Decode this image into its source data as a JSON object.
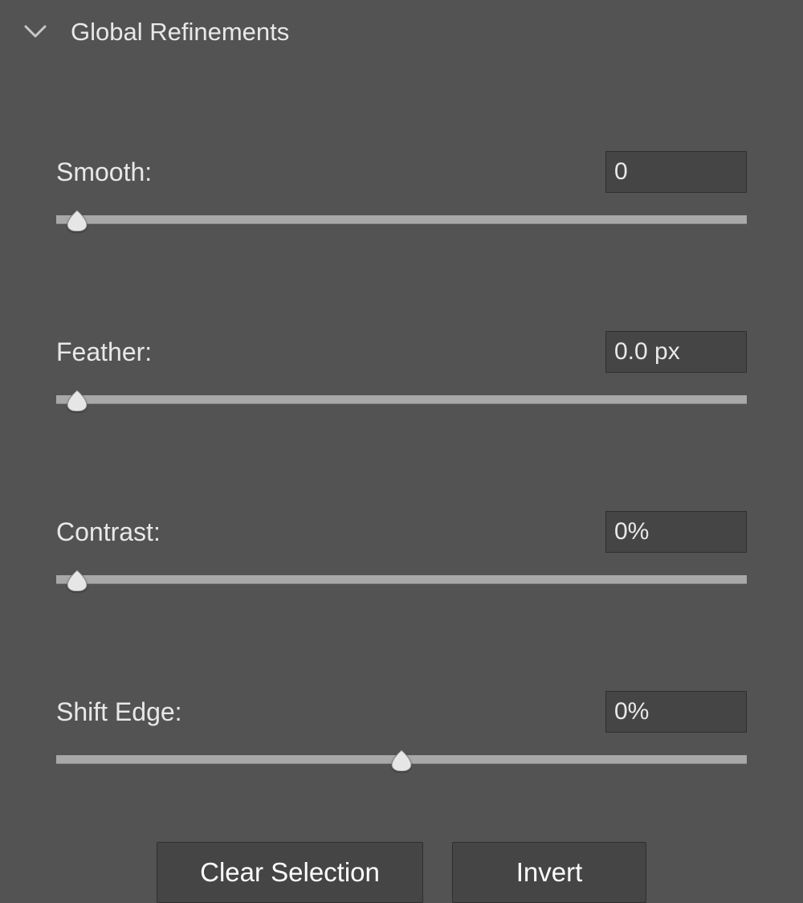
{
  "section": {
    "title": "Global Refinements"
  },
  "controls": {
    "smooth": {
      "label": "Smooth:",
      "value": "0",
      "thumb_percent": 3
    },
    "feather": {
      "label": "Feather:",
      "value": "0.0 px",
      "thumb_percent": 3
    },
    "contrast": {
      "label": "Contrast:",
      "value": "0%",
      "thumb_percent": 3
    },
    "shift_edge": {
      "label": "Shift Edge:",
      "value": "0%",
      "thumb_percent": 50
    }
  },
  "buttons": {
    "clear": "Clear Selection",
    "invert": "Invert"
  }
}
